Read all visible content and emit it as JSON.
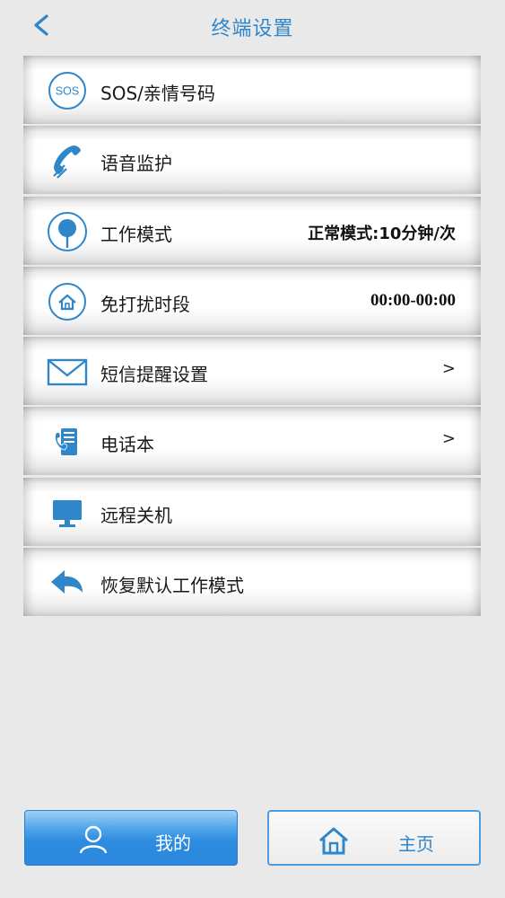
{
  "header": {
    "title": "终端设置",
    "back_icon": "chevron-left-icon"
  },
  "menu": {
    "items": [
      {
        "label": "SOS/亲情号码",
        "value": "",
        "icon": "sos-icon"
      },
      {
        "label": "语音监护",
        "value": "",
        "icon": "phone-handset-icon"
      },
      {
        "label": "工作模式",
        "value": "正常模式:10分钟/次",
        "icon": "location-pin-icon"
      },
      {
        "label": "免打扰时段",
        "value": "00:00-00:00",
        "icon": "home-circle-icon"
      },
      {
        "label": "短信提醒设置",
        "value": ">",
        "icon": "envelope-icon"
      },
      {
        "label": "电话本",
        "value": ">",
        "icon": "phonebook-icon"
      },
      {
        "label": "远程关机",
        "value": "",
        "icon": "monitor-icon"
      },
      {
        "label": "恢复默认工作模式",
        "value": "",
        "icon": "undo-arrow-icon"
      }
    ]
  },
  "bottom_nav": {
    "mine_label": "我的",
    "home_label": "主页"
  },
  "colors": {
    "accent": "#2f86c9",
    "active_tab": "#2d8ce0"
  }
}
